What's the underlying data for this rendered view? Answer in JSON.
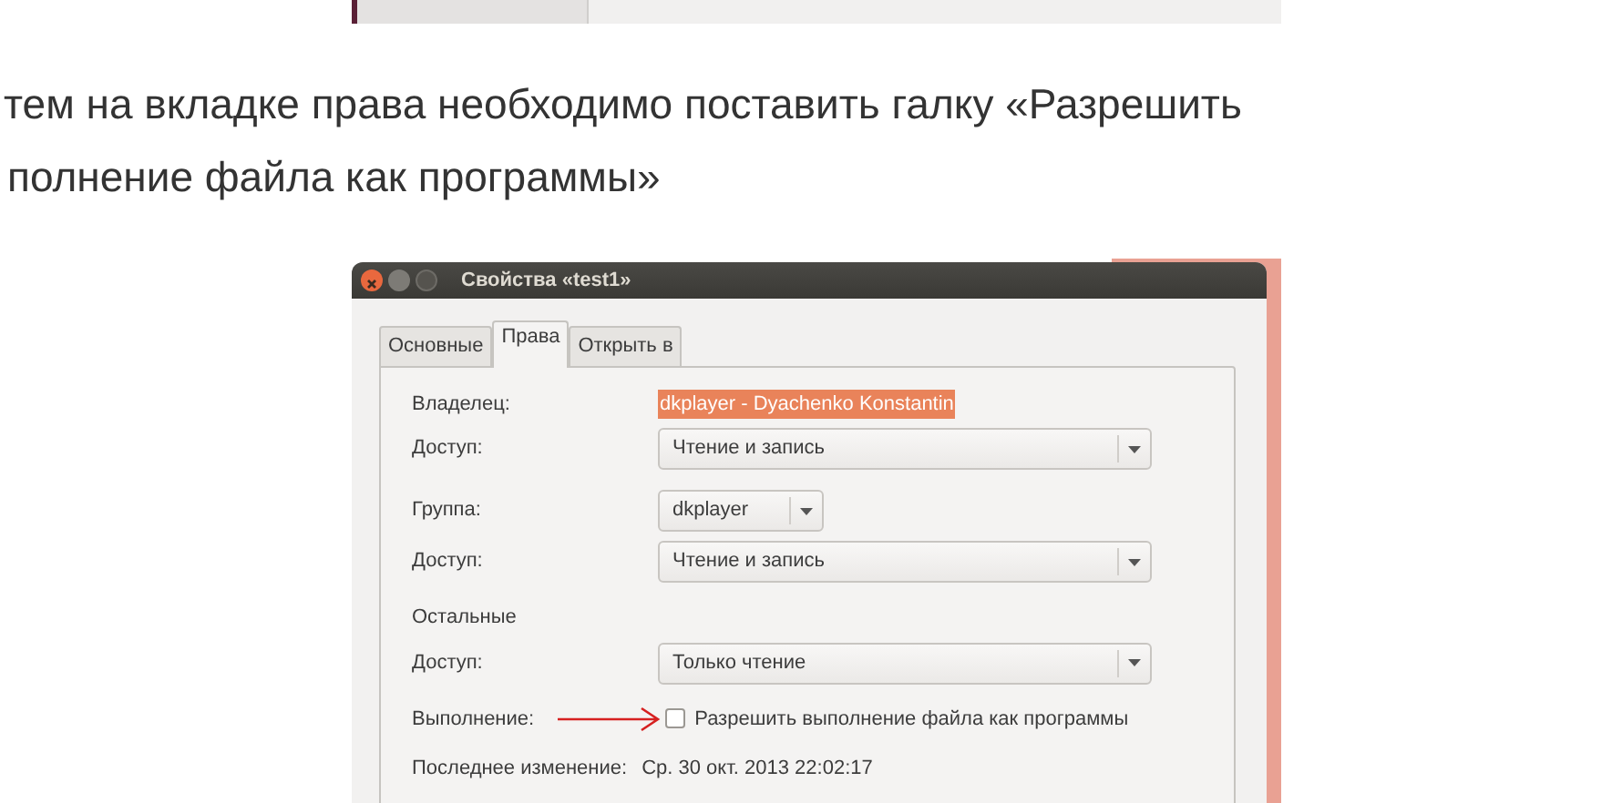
{
  "paragraph": {
    "lines": [
      "тем на вкладке права необходимо поставить галку «Разрешить",
      "полнение файла как программы»"
    ]
  },
  "dialog": {
    "title": "Свойства «test1»",
    "tabs": [
      {
        "label": "Основные",
        "selected": false
      },
      {
        "label": "Права",
        "selected": true
      },
      {
        "label": "Открыть в",
        "selected": false
      }
    ],
    "sections": [
      [
        {
          "kind": "highlighted",
          "label": "Владелец:",
          "value": "dkplayer - Dyachenko Konstantin"
        },
        {
          "kind": "dropdown",
          "wide": true,
          "label": "Доступ:",
          "value": "Чтение и запись"
        }
      ],
      [
        {
          "kind": "dropdown",
          "wide": false,
          "label": "Группа:",
          "value": "dkplayer"
        },
        {
          "kind": "dropdown",
          "wide": true,
          "label": "Доступ:",
          "value": "Чтение и запись"
        }
      ],
      [
        {
          "kind": "heading",
          "label": "Остальные"
        },
        {
          "kind": "dropdown",
          "wide": true,
          "label": "Доступ:",
          "value": "Только чтение"
        }
      ],
      [
        {
          "kind": "checkbox",
          "label": "Выполнение:",
          "value": "Разрешить выполнение файла как программы",
          "checked": false,
          "annotated": true
        }
      ],
      [
        {
          "kind": "text",
          "label": "Последнее изменение:",
          "value": "Ср. 30 окт. 2013 22:02:17"
        }
      ]
    ]
  }
}
